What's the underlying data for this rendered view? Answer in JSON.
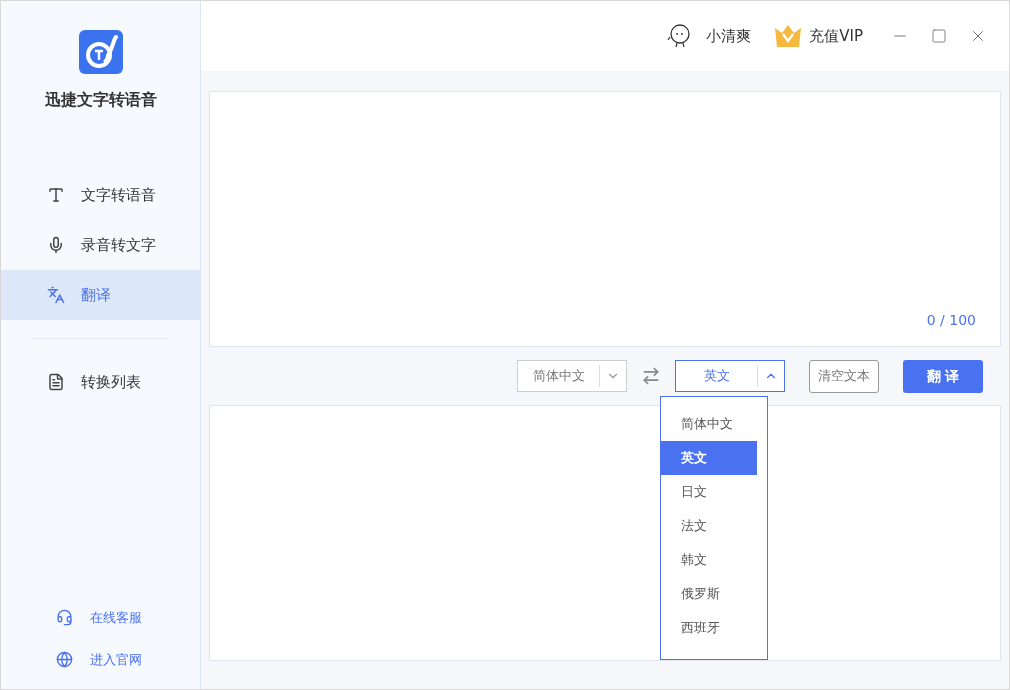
{
  "app": {
    "name": "迅捷文字转语音"
  },
  "sidebar": {
    "items": [
      {
        "kind": "text",
        "label": "文字转语音",
        "selected": false
      },
      {
        "kind": "mic",
        "label": "录音转文字",
        "selected": false
      },
      {
        "kind": "translate",
        "label": "翻译",
        "selected": true
      }
    ],
    "secondary": [
      {
        "kind": "list",
        "label": "转换列表",
        "selected": false
      }
    ],
    "links": [
      {
        "kind": "support",
        "label": "在线客服"
      },
      {
        "kind": "web",
        "label": "进入官网"
      }
    ]
  },
  "header": {
    "user": "小清爽",
    "vip": "充值VIP"
  },
  "input": {
    "counter": "0 / 100"
  },
  "toolbar": {
    "source": "简体中文",
    "target": "英文",
    "target_open": true,
    "clear": "清空文本",
    "translate": "翻 译"
  },
  "dropdown": [
    {
      "label": "简体中文",
      "selected": false
    },
    {
      "label": "英文",
      "selected": true
    },
    {
      "label": "日文",
      "selected": false
    },
    {
      "label": "法文",
      "selected": false
    },
    {
      "label": "韩文",
      "selected": false
    },
    {
      "label": "俄罗斯",
      "selected": false
    },
    {
      "label": "西班牙",
      "selected": false
    }
  ]
}
